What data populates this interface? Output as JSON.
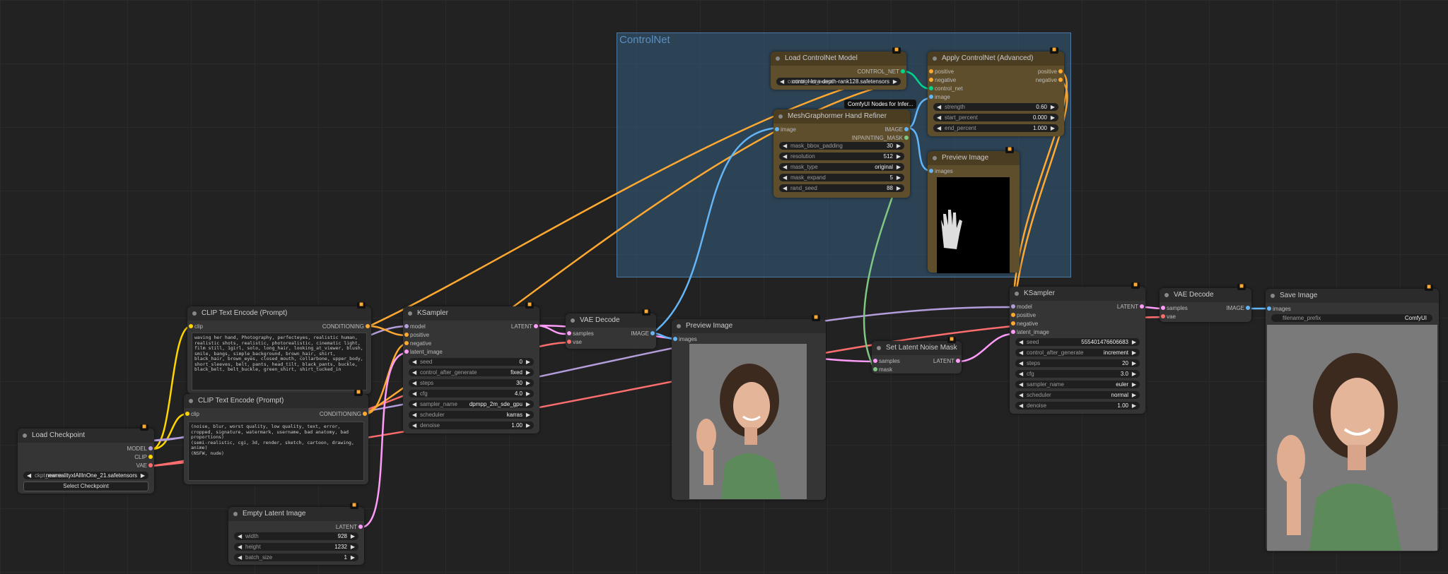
{
  "group": {
    "title": "ControlNet"
  },
  "colors": {
    "clip": "#ffd500",
    "model": "#b39ddb",
    "vae": "#ff6e6e",
    "conditioning": "#ffa931",
    "latent": "#ff9cf9",
    "image": "#64b5f6",
    "mask": "#81c784",
    "control_net": "#00d78d"
  },
  "load_checkpoint": {
    "title": "Load Checkpoint",
    "outputs": [
      "MODEL",
      "CLIP",
      "VAE"
    ],
    "ckpt_label": "ckpt_name",
    "ckpt_value": "newrealityxlAllInOne_21.safetensors",
    "button": "Select Checkpoint"
  },
  "clip_pos": {
    "title": "CLIP Text Encode (Prompt)",
    "input": "clip",
    "output": "CONDITIONING",
    "text": "waving her hand, Photography, perfecteyes, realistic human, realistic shots, realistic, photorealistic, cinematic light, film still, 1girl, solo, long_hair, looking_at_viewer, blush, smile, bangs, simple_background, brown_hair, shirt, black_hair, brown_eyes, closed_mouth, collarbone, upper_body, short_sleeves, belt, pants, head_tilt, black_pants, buckle, black_belt, belt_buckle, green_shirt, shirt_tucked_in"
  },
  "clip_neg": {
    "title": "CLIP Text Encode (Prompt)",
    "input": "clip",
    "output": "CONDITIONING",
    "text": "(noise, blur, worst quality, low quality, text, error, cropped, signature, watermark, username, bad anatomy, bad proportions)\n(semi-realistic, cgi, 3d, render, sketch, cartoon, drawing, anime)\n(NSFW, nude)"
  },
  "empty_latent": {
    "title": "Empty Latent Image",
    "output": "LATENT",
    "widgets": [
      {
        "label": "width",
        "value": "928"
      },
      {
        "label": "height",
        "value": "1232"
      },
      {
        "label": "batch_size",
        "value": "1"
      }
    ]
  },
  "ksampler1": {
    "title": "KSampler",
    "inputs": [
      "model",
      "positive",
      "negative",
      "latent_image"
    ],
    "output": "LATENT",
    "widgets": [
      {
        "label": "seed",
        "value": "0"
      },
      {
        "label": "control_after_generate",
        "value": "fixed"
      },
      {
        "label": "steps",
        "value": "30"
      },
      {
        "label": "cfg",
        "value": "4.0"
      },
      {
        "label": "sampler_name",
        "value": "dpmpp_2m_sde_gpu"
      },
      {
        "label": "scheduler",
        "value": "karras"
      },
      {
        "label": "denoise",
        "value": "1.00"
      }
    ]
  },
  "vae_decode1": {
    "title": "VAE Decode",
    "inputs": [
      "samples",
      "vae"
    ],
    "output": "IMAGE"
  },
  "preview1": {
    "title": "Preview Image",
    "input": "images"
  },
  "load_controlnet": {
    "title": "Load ControlNet Model",
    "output": "CONTROL_NET",
    "widget_label": "control_net_name",
    "widget_value": "control-lora-depth-rank128.safetensors"
  },
  "tooltip": "ComfyUI Nodes for Infer...",
  "mesh": {
    "title": "MeshGraphormer Hand Refiner",
    "input": "image",
    "outputs": [
      "IMAGE",
      "INPAINTING_MASK"
    ],
    "widgets": [
      {
        "label": "mask_bbox_padding",
        "value": "30"
      },
      {
        "label": "resolution",
        "value": "512"
      },
      {
        "label": "mask_type",
        "value": "original"
      },
      {
        "label": "mask_expand",
        "value": "5"
      },
      {
        "label": "rand_seed",
        "value": "88"
      }
    ]
  },
  "apply_cn": {
    "title": "Apply ControlNet (Advanced)",
    "inputs": [
      "positive",
      "negative",
      "control_net",
      "image"
    ],
    "outputs": [
      "positive",
      "negative"
    ],
    "widgets": [
      {
        "label": "strength",
        "value": "0.60"
      },
      {
        "label": "start_percent",
        "value": "0.000"
      },
      {
        "label": "end_percent",
        "value": "1.000"
      }
    ]
  },
  "preview_mask": {
    "title": "Preview Image",
    "input": "images"
  },
  "latent_mask": {
    "title": "Set Latent Noise Mask",
    "inputs": [
      "samples",
      "mask"
    ],
    "output": "LATENT"
  },
  "ksampler2": {
    "title": "KSampler",
    "inputs": [
      "model",
      "positive",
      "negative",
      "latent_image"
    ],
    "output": "LATENT",
    "widgets": [
      {
        "label": "seed",
        "value": "555401476606683"
      },
      {
        "label": "control_after_generate",
        "value": "increment"
      },
      {
        "label": "steps",
        "value": "20"
      },
      {
        "label": "cfg",
        "value": "3.0"
      },
      {
        "label": "sampler_name",
        "value": "euler"
      },
      {
        "label": "scheduler",
        "value": "normal"
      },
      {
        "label": "denoise",
        "value": "1.00"
      }
    ]
  },
  "vae_decode2": {
    "title": "VAE Decode",
    "inputs": [
      "samples",
      "vae"
    ],
    "output": "IMAGE"
  },
  "save_image": {
    "title": "Save Image",
    "input": "images",
    "widget_label": "filename_prefix",
    "widget_value": "ComfyUI"
  },
  "badge_icon": "fox-icon"
}
